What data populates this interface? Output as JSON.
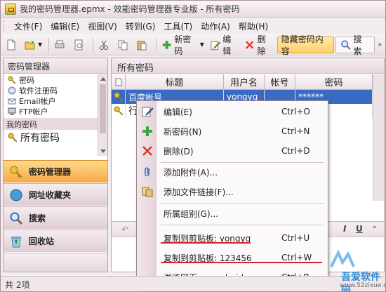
{
  "window": {
    "title": "我的密码管理器.epmx - 效能密码管理器专业版 - 所有密码"
  },
  "menubar": [
    "文件(F)",
    "编辑(E)",
    "视图(V)",
    "转到(G)",
    "工具(T)",
    "动作(A)",
    "帮助(H)"
  ],
  "toolbar": {
    "new_pw": "新密码",
    "edit": "编辑",
    "delete": "删除",
    "hide": "隐藏密码内容",
    "search": "搜索"
  },
  "left": {
    "header": "密码管理器",
    "tree": [
      "密码",
      "软件注册码",
      "Email帐户",
      "FTP帐户"
    ],
    "section": "我的密码",
    "all": "所有密码",
    "nav": [
      "密码管理器",
      "网址收藏夹",
      "搜索",
      "回收站"
    ]
  },
  "right": {
    "header": "所有密码",
    "columns": [
      "标题",
      "用户名",
      "帐号",
      "密码"
    ],
    "rows": [
      {
        "title": "百度帐号",
        "user": "yongyg",
        "account": "",
        "password": "******"
      },
      {
        "title": "行",
        "user": "",
        "account": "",
        "password": ""
      }
    ]
  },
  "context_menu": [
    {
      "label": "编辑(E)",
      "key": "Ctrl+O",
      "icon": "edit-icon"
    },
    {
      "label": "新密码(N)",
      "key": "Ctrl+N",
      "icon": "plus-icon"
    },
    {
      "label": "删除(D)",
      "key": "Ctrl+D",
      "icon": "delete-icon"
    },
    {
      "label": "添加附件(A)...",
      "key": "",
      "icon": "paperclip-icon"
    },
    {
      "label": "添加文件链接(F)...",
      "key": "",
      "icon": "file-link-icon"
    },
    {
      "label": "所属组别(G)...",
      "key": "",
      "icon": ""
    },
    {
      "label": "复制到剪贴板: yongyg",
      "key": "Ctrl+U",
      "icon": ""
    },
    {
      "label": "复制到剪贴板: 123456",
      "key": "Ctrl+W",
      "icon": ""
    },
    {
      "label": "浏览网页: www.baidu.com",
      "key": "Ctrl+B",
      "icon": ""
    }
  ],
  "status": "共 2项",
  "watermark": {
    "name": "吾爱软件园",
    "url": "www.52zixue.com"
  },
  "colors": {
    "accent_orange": "#f6a945",
    "selection": "#3a6bc4",
    "underline_red": "#d6262a"
  }
}
